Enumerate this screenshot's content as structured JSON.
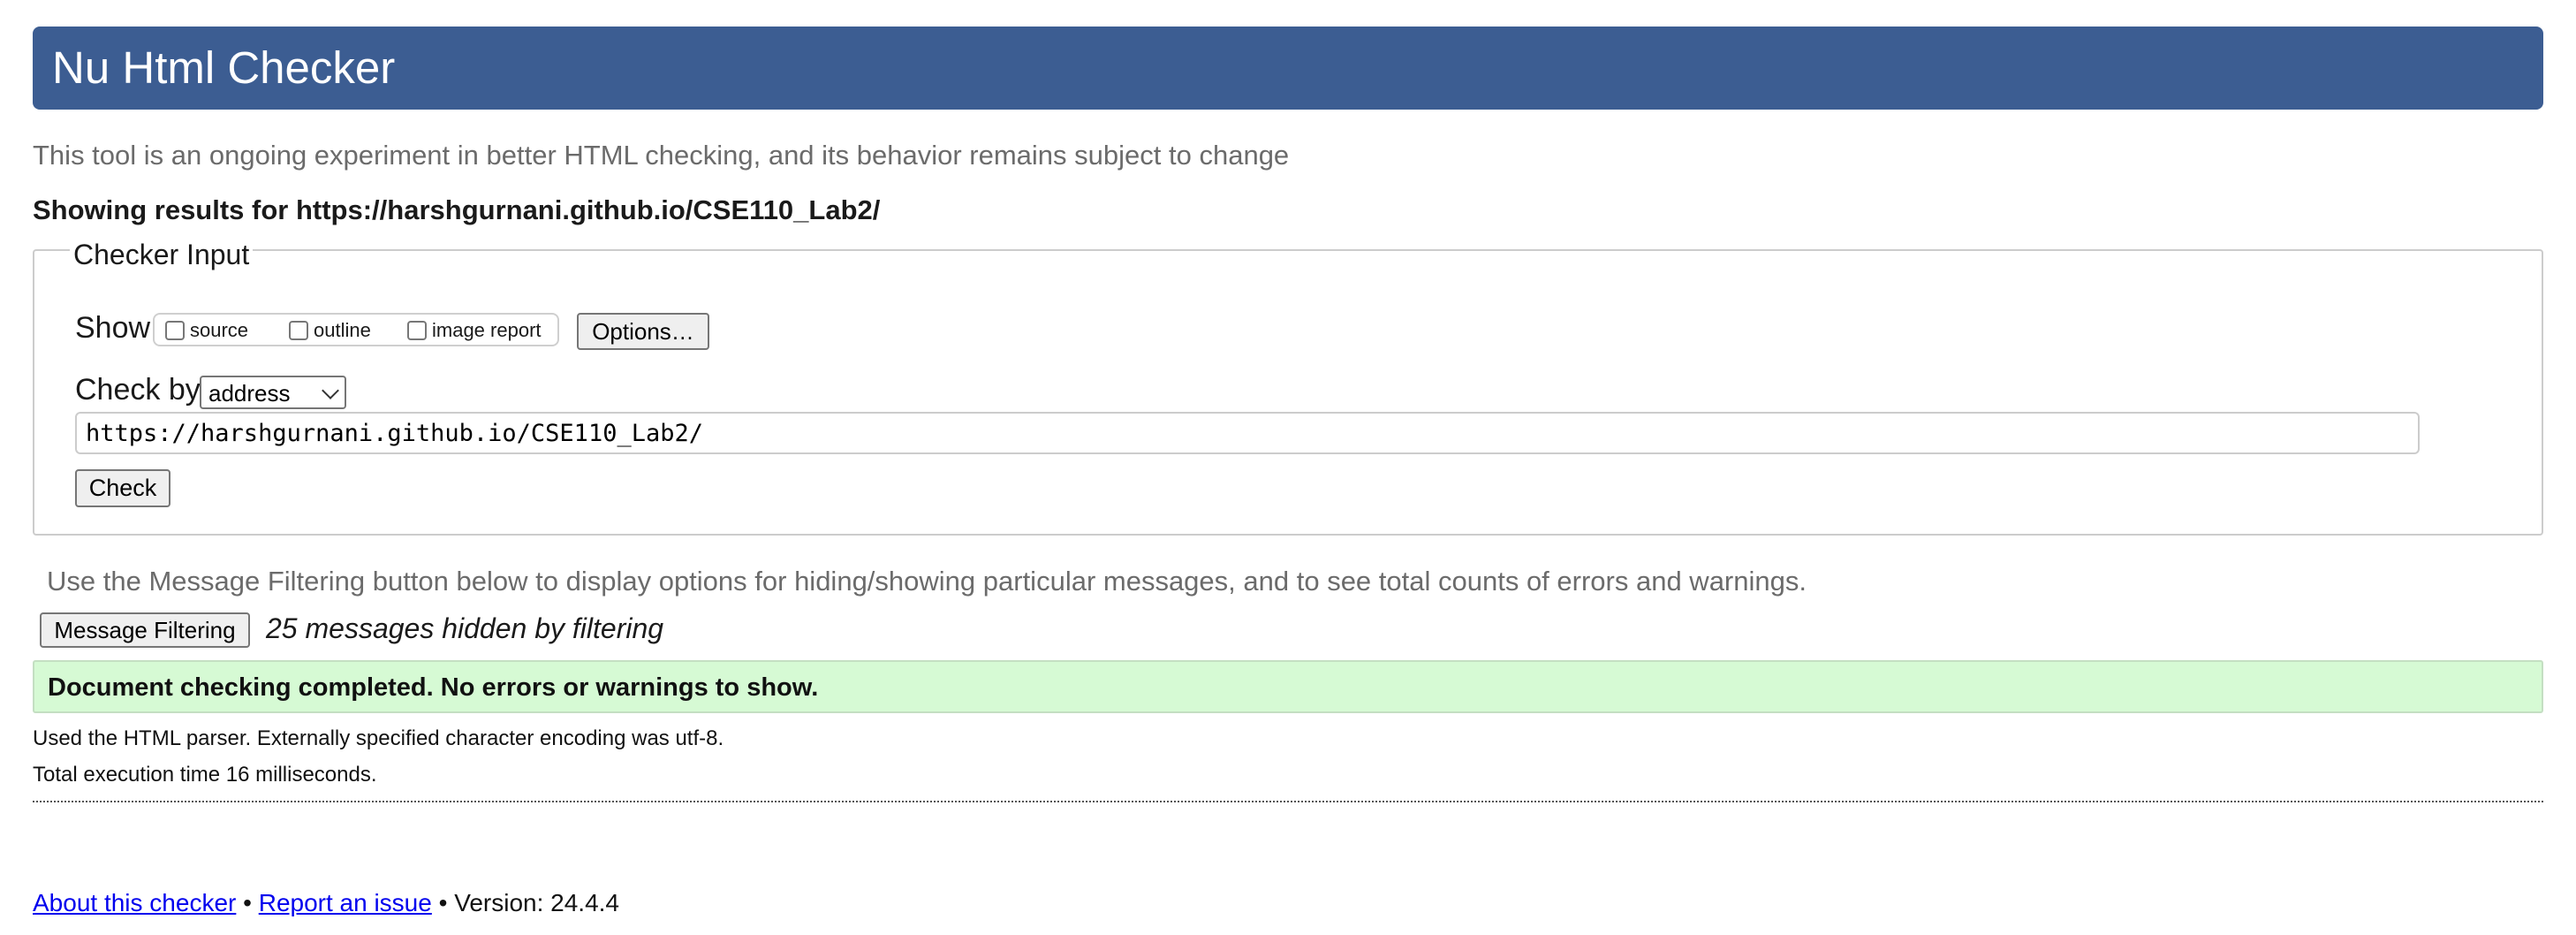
{
  "header": {
    "title": "Nu Html Checker"
  },
  "tagline": "This tool is an ongoing experiment in better HTML checking, and its behavior remains subject to change",
  "showing_results": "Showing results for https://harshgurnani.github.io/CSE110_Lab2/",
  "checker_input": {
    "legend": "Checker Input",
    "show_label": "Show",
    "show_options": [
      {
        "label": "source",
        "checked": false
      },
      {
        "label": "outline",
        "checked": false
      },
      {
        "label": "image report",
        "checked": false
      }
    ],
    "options_button": "Options…",
    "check_by_label": "Check by",
    "check_by_selected": "address",
    "url_value": "https://harshgurnani.github.io/CSE110_Lab2/",
    "check_button": "Check"
  },
  "filtering": {
    "note": "Use the Message Filtering button below to display options for hiding/showing particular messages, and to see total counts of errors and warnings.",
    "button": "Message Filtering",
    "hidden_count": "25 messages hidden by filtering"
  },
  "result": {
    "message": "Document checking completed. No errors or warnings to show.",
    "color": "#d6fad4"
  },
  "meta": {
    "parser": "Used the HTML parser. Externally specified character encoding was utf-8.",
    "time": "Total execution time 16 milliseconds."
  },
  "footer": {
    "about": "About this checker",
    "separator": "•",
    "report": "Report an issue",
    "version": "Version: 24.4.4"
  },
  "colors": {
    "header_bg": "#3c5d92",
    "link": "#0000ee"
  }
}
